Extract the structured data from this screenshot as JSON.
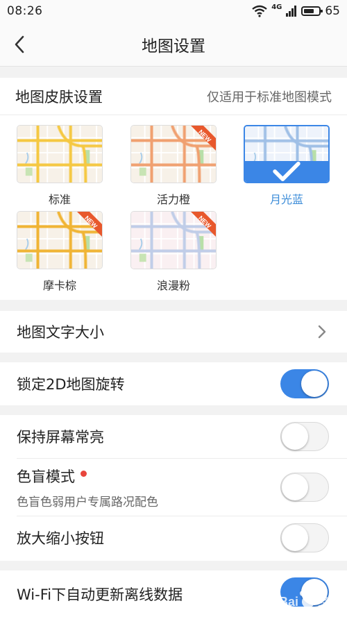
{
  "status": {
    "time": "08:26",
    "network": "4G",
    "battery": "65"
  },
  "header": {
    "title": "地图设置"
  },
  "skin": {
    "title": "地图皮肤设置",
    "note": "仅适用于标准地图模式",
    "badge": "NEW",
    "options": [
      {
        "label": "标准",
        "new": false,
        "selected": false,
        "road_color": "#f5c842"
      },
      {
        "label": "活力橙",
        "new": true,
        "selected": false,
        "road_color": "#f0a070"
      },
      {
        "label": "月光蓝",
        "new": false,
        "selected": true,
        "road_color": "#9fbfe6"
      },
      {
        "label": "摩卡棕",
        "new": true,
        "selected": false,
        "road_color": "#f0b434"
      },
      {
        "label": "浪漫粉",
        "new": true,
        "selected": false,
        "road_color": "#c0cde8"
      }
    ]
  },
  "settings": {
    "font_size": {
      "label": "地图文字大小"
    },
    "lock_2d": {
      "label": "锁定2D地图旋转",
      "on": true
    },
    "screen_on": {
      "label": "保持屏幕常亮",
      "on": false
    },
    "colorblind": {
      "label": "色盲模式",
      "sub": "色盲色弱用户专属路况配色",
      "on": false
    },
    "zoom_buttons": {
      "label": "放大缩小按钮",
      "on": false
    },
    "wifi_update": {
      "label": "Wi-Fi下自动更新离线数据",
      "on": true
    }
  },
  "colors": {
    "accent": "#3b86e6",
    "accent_text": "#3a8bd8",
    "new_badge": "#e8582c",
    "dot": "#e8453c"
  }
}
